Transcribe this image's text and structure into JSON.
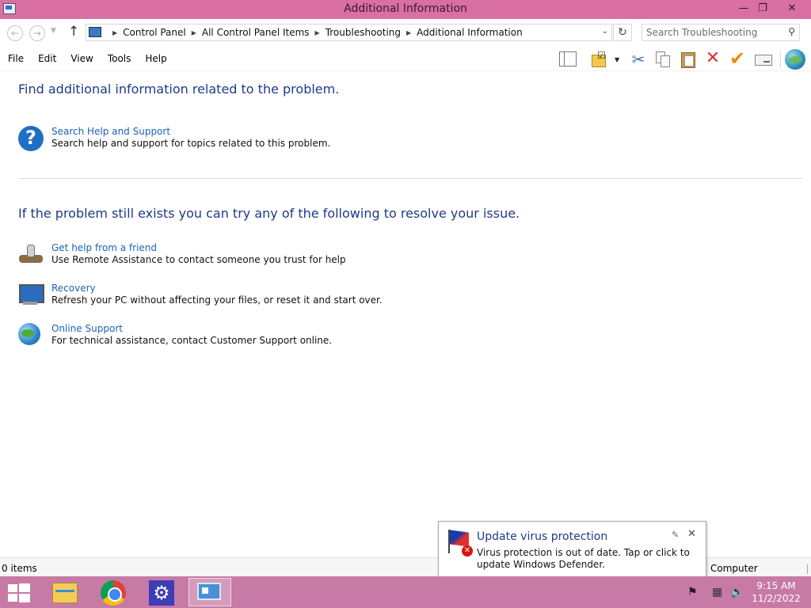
{
  "window": {
    "title": "Additional Information",
    "minimize": "—",
    "maximize": "❐",
    "close": "✕"
  },
  "nav": {
    "back": "←",
    "forward": "→",
    "recent": "▼",
    "up": "↑"
  },
  "address": {
    "breadcrumbs": [
      "Control Panel",
      "All Control Panel Items",
      "Troubleshooting",
      "Additional Information"
    ],
    "separator": "▶",
    "dropdown": "⌄",
    "refresh": "↻"
  },
  "search": {
    "placeholder": "Search Troubleshooting",
    "icon": "⚲"
  },
  "menu": {
    "items": [
      "File",
      "Edit",
      "View",
      "Tools",
      "Help"
    ]
  },
  "toolbar": {
    "icons": [
      "preview-pane-icon",
      "folder-check-icon",
      "cut-icon",
      "copy-icon",
      "paste-icon",
      "delete-icon",
      "checkmark-icon",
      "properties-icon",
      "globe-icon"
    ],
    "cut": "✂",
    "delete": "✕",
    "check": "✔",
    "folder_dd": "▼",
    "folder_check": "☑"
  },
  "content": {
    "heading1": "Find additional information related to the problem.",
    "heading2": "If the problem still exists you can try any of the following to resolve your issue.",
    "tasks": [
      {
        "link": "Search Help and Support",
        "desc": "Search help and support for topics related to this problem.",
        "icon": "help-icon",
        "glyph": "?"
      },
      {
        "link": "Get help from a friend",
        "desc": "Use Remote Assistance to contact someone you trust for help",
        "icon": "remote-assistance-icon"
      },
      {
        "link": "Recovery",
        "desc": "Refresh your PC without affecting your files, or reset it and start over.",
        "icon": "recovery-icon"
      },
      {
        "link": "Online Support",
        "desc": "For technical assistance, contact Customer Support online.",
        "icon": "globe-icon"
      }
    ]
  },
  "status": {
    "items": "0 items",
    "location": "Computer"
  },
  "notification": {
    "title": "Update virus protection",
    "body": "Virus protection is out of date. Tap or click to update Windows Defender.",
    "pin": "✎",
    "close": "✕",
    "error_glyph": "✕"
  },
  "taskbar": {
    "apps": [
      "file-explorer-icon",
      "chrome-icon",
      "settings-icon",
      "control-panel-icon"
    ],
    "settings_glyph": "⚙",
    "tray": {
      "flag": "⚑",
      "network": "▦",
      "volume": "🔈"
    },
    "clock_time": "9:15 AM",
    "clock_date": "11/2/2022"
  },
  "colors": {
    "titlebar": "#d96fa3",
    "taskbar": "#c77aa5",
    "heading": "#1e3a8a",
    "link": "#1a62b8"
  }
}
